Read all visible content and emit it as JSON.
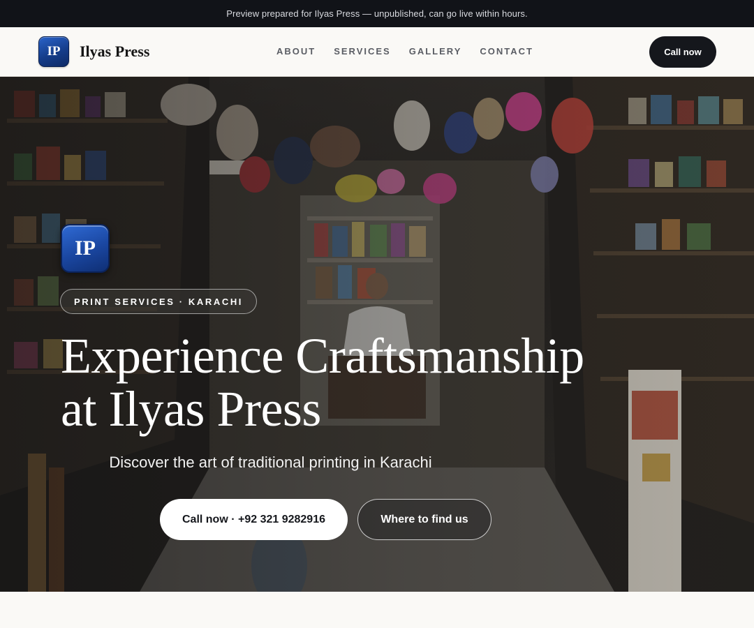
{
  "banner": {
    "text": "Preview prepared for Ilyas Press — unpublished, can go live within hours."
  },
  "nav": {
    "logo_text": "IP",
    "brand_name": "Ilyas Press",
    "links": [
      {
        "label": "ABOUT"
      },
      {
        "label": "SERVICES"
      },
      {
        "label": "GALLERY"
      },
      {
        "label": "CONTACT"
      }
    ],
    "cta_label": "Call now"
  },
  "hero": {
    "logo_text": "IP",
    "pill_label": "PRINT SERVICES · KARACHI",
    "title_line1": "Experience Craftsmanship",
    "title_line2": "at Ilyas Press",
    "subtitle": "Discover the art of traditional printing in Karachi",
    "primary_button": "Call now · +92 321 9282916",
    "secondary_button": "Where to find us",
    "background_icon": "shop-interior-photo"
  },
  "colors": {
    "banner_bg": "#111318",
    "nav_bg": "#faf9f6",
    "brand_blue": "#1a46a0",
    "cta_dark": "#15171c"
  }
}
